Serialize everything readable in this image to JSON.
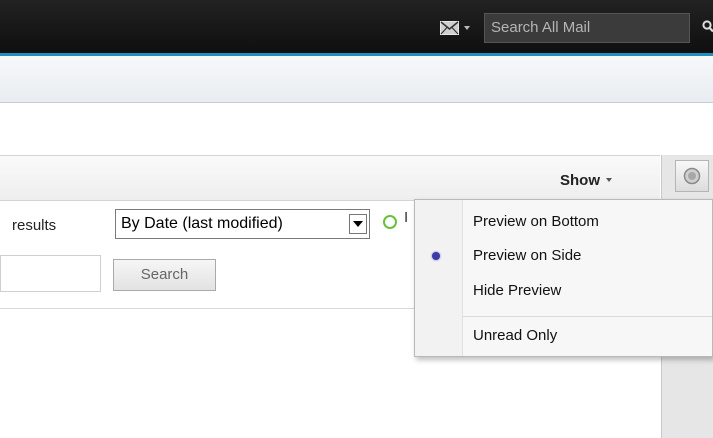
{
  "header": {
    "search_placeholder": "Search All Mail",
    "mail_icon": "envelope-icon",
    "search_icon": "magnifier-icon"
  },
  "toolbar": {
    "show_label": "Show",
    "chat_icon": "chat-bubble-icon"
  },
  "filter": {
    "results_label": "results",
    "sort_selected": "By Date (last modified)",
    "status_cut_text": "I",
    "search_button": "Search"
  },
  "show_menu": {
    "items": [
      {
        "label": "Preview on Bottom",
        "selected": false
      },
      {
        "label": "Preview on Side",
        "selected": true
      },
      {
        "label": "Hide Preview",
        "selected": false
      },
      {
        "label": "Unread Only",
        "selected": false
      }
    ]
  },
  "colors": {
    "accent": "#1e8fc0",
    "topbar": "#1a1a1a",
    "status_green": "#66c23a",
    "radio": "#3a3aa8"
  }
}
